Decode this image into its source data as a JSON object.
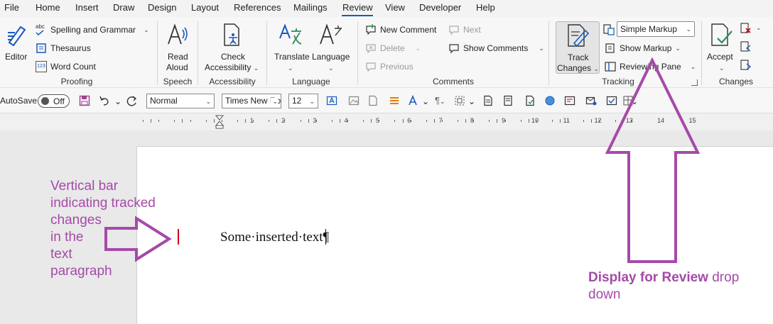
{
  "menu": {
    "items": [
      "File",
      "Home",
      "Insert",
      "Draw",
      "Design",
      "Layout",
      "References",
      "Mailings",
      "Review",
      "View",
      "Developer",
      "Help"
    ],
    "active": "Review"
  },
  "ribbon": {
    "proofing": {
      "label": "Proofing",
      "editor": "Editor",
      "spelling": "Spelling and Grammar",
      "thesaurus": "Thesaurus",
      "word_count": "Word Count",
      "abc_glyph": "abc",
      "count_glyph": "123"
    },
    "speech": {
      "label": "Speech",
      "read_aloud_1": "Read",
      "read_aloud_2": "Aloud"
    },
    "accessibility": {
      "label": "Accessibility",
      "check_1": "Check",
      "check_2": "Accessibility"
    },
    "language": {
      "label": "Language",
      "translate": "Translate",
      "language": "Language"
    },
    "comments": {
      "label": "Comments",
      "new_comment": "New Comment",
      "delete": "Delete",
      "previous": "Previous",
      "next": "Next",
      "show_comments": "Show Comments"
    },
    "tracking": {
      "label": "Tracking",
      "track_changes_1": "Track",
      "track_changes_2": "Changes",
      "display_for_review": "Simple Markup",
      "show_markup": "Show Markup",
      "reviewing_pane": "Reviewing Pane"
    },
    "changes": {
      "label": "Changes",
      "accept": "Accept"
    }
  },
  "qat": {
    "autosave": "AutoSave",
    "autosave_state": "Off",
    "style": "Normal",
    "font": "Times New Roman",
    "size": "12"
  },
  "ruler": {
    "numbers": [
      "1",
      "2",
      "3",
      "4",
      "5",
      "6",
      "7",
      "8",
      "9",
      "10",
      "11",
      "12",
      "13",
      "14",
      "15"
    ]
  },
  "document": {
    "text": "Some·inserted·text¶"
  },
  "annotations": {
    "left": [
      "Vertical bar",
      "indicating tracked",
      "changes",
      "in the",
      "text",
      "paragraph"
    ],
    "right_bold": "Display for Review",
    "right_rest": " drop down"
  },
  "colors": {
    "accent": "#185abd",
    "annotation": "#a54aa8",
    "change_bar": "#d0021b"
  }
}
